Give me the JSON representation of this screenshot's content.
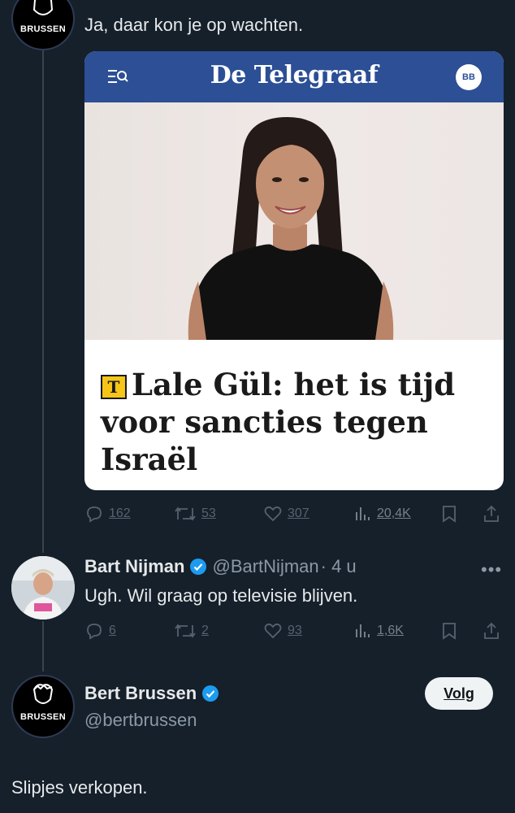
{
  "reply_tweet": {
    "author_avatar_text": "BRUSSEN",
    "text": "Ja, daar kon je op wachten."
  },
  "card": {
    "site_logo": "De Telegraaf",
    "user_badge": "BB",
    "headline_badge": "T",
    "headline": "Lale Gül: het is tijd voor sancties tegen Israël"
  },
  "actions_1": {
    "replies": "162",
    "retweets": "53",
    "likes": "307",
    "views": "20,4K"
  },
  "tweet_2": {
    "name": "Bart Nijman",
    "handle": "@BartNijman",
    "time": "· 4 u",
    "more": "•••",
    "text": "Ugh. Wil graag op televisie blijven."
  },
  "actions_2": {
    "replies": "6",
    "retweets": "2",
    "likes": "93",
    "views": "1,6K"
  },
  "tweet_3": {
    "name": "Bert Brussen",
    "handle": "@bertbrussen",
    "follow_label": "Volg",
    "avatar_text": "BRUSSEN",
    "text": "Slipjes verkopen."
  },
  "colors": {
    "background": "#15202b",
    "verified": "#1d9bf0",
    "telegraaf_blue": "#2c4f95",
    "muted": "#8b98a5"
  }
}
